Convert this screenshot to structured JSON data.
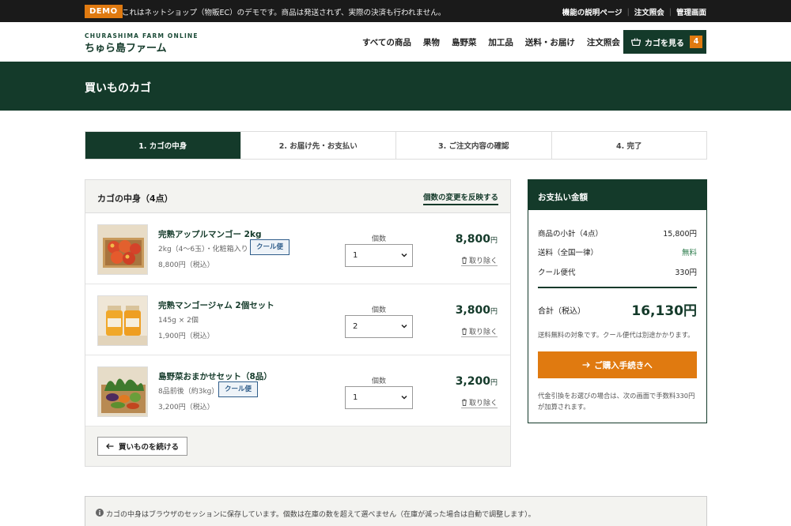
{
  "topbar": {
    "badge": "DEMO",
    "notice": "これはネットショップ（物販EC）のデモです。商品は発送されず、実際の決済も行われません。",
    "links": [
      "機能の説明ページ",
      "注文照会",
      "管理画面"
    ]
  },
  "header": {
    "brand_sub": "CHURASHIMA FARM ONLINE",
    "brand_name": "ちゅら島ファーム",
    "nav": [
      "すべての商品",
      "果物",
      "島野菜",
      "加工品",
      "送料・お届け",
      "注文照会"
    ],
    "cart_label": "カゴを見る",
    "cart_count": "4"
  },
  "page": {
    "title": "買いものカゴ"
  },
  "steps": [
    "1. カゴの中身",
    "2. お届け先・お支払い",
    "3. ご注文内容の確認",
    "4. 完了"
  ],
  "cart": {
    "title": "カゴの中身（4点）",
    "update_link": "個数の変更を反映する",
    "qty_label": "個数",
    "remove_label": "取り除く",
    "yen_suffix": "円",
    "items": [
      {
        "name": "完熟アップルマンゴー 2kg",
        "spec": "2kg（4〜6玉）・化粧箱入り",
        "badge": "クール便",
        "unit_price": "8,800円（税込）",
        "qty": "1",
        "total": "8,800"
      },
      {
        "name": "完熟マンゴージャム 2個セット",
        "spec": "145g × 2個",
        "badge": "",
        "unit_price": "1,900円（税込）",
        "qty": "2",
        "total": "3,800"
      },
      {
        "name": "島野菜おまかせセット（8品）",
        "spec": "8品前後（約3kg）",
        "badge": "クール便",
        "unit_price": "3,200円（税込）",
        "qty": "1",
        "total": "3,200"
      }
    ],
    "continue_label": "買いものを続ける"
  },
  "summary": {
    "title": "お支払い金額",
    "rows": [
      {
        "label": "商品の小計（4点）",
        "value": "15,800円"
      },
      {
        "label": "送料（全国一律）",
        "value": "無料"
      },
      {
        "label": "クール便代",
        "value": "330円"
      }
    ],
    "total_label": "合計（税込）",
    "total_value": "16,130円",
    "note": "送料無料の対象です。クール便代は別途かかります。",
    "checkout_label": "ご購入手続きへ",
    "cod_note": "代金引換をお選びの場合は、次の画面で手数料330円が加算されます。"
  },
  "info": {
    "text": "カゴの中身はブラウザのセッションに保存しています。個数は在庫の数を超えて選べません（在庫が減った場合は自動で調整します）。"
  }
}
